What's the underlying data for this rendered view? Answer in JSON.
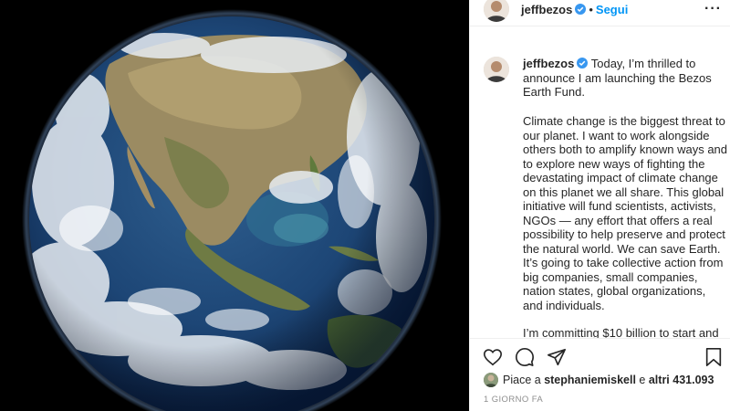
{
  "post": {
    "username": "jeffbezos",
    "follow_label": "Segui",
    "more_icon": "more-options-icon",
    "verified_icon": "verified-badge-icon",
    "brand_color": "#0095f6",
    "verified_color": "#3897f0"
  },
  "caption": {
    "username": "jeffbezos",
    "intro": "Today, I’m thrilled to announce I am launching the Bezos Earth Fund.",
    "body": "Climate change is the biggest threat to our planet. I want to work alongside others both to amplify known ways and to explore new ways of fighting the devastating impact of climate change on this planet we all share. This global initiative will fund scientists, activists, NGOs — any effort that offers a real possibility to help preserve and protect the natural world. We can save Earth. It’s going to take collective action from big companies, small companies, nation states, global organizations, and individuals.",
    "cut_line": "I’m committing $10 billion to start and"
  },
  "actions": {
    "like_icon": "heart-icon",
    "comment_icon": "comment-icon",
    "share_icon": "paper-plane-icon",
    "save_icon": "bookmark-icon"
  },
  "likes": {
    "prefix": "Piace a",
    "user": "stephaniemiskell",
    "middle": "e",
    "others": "altri 431.093"
  },
  "timestamp": "1 giorno fa"
}
